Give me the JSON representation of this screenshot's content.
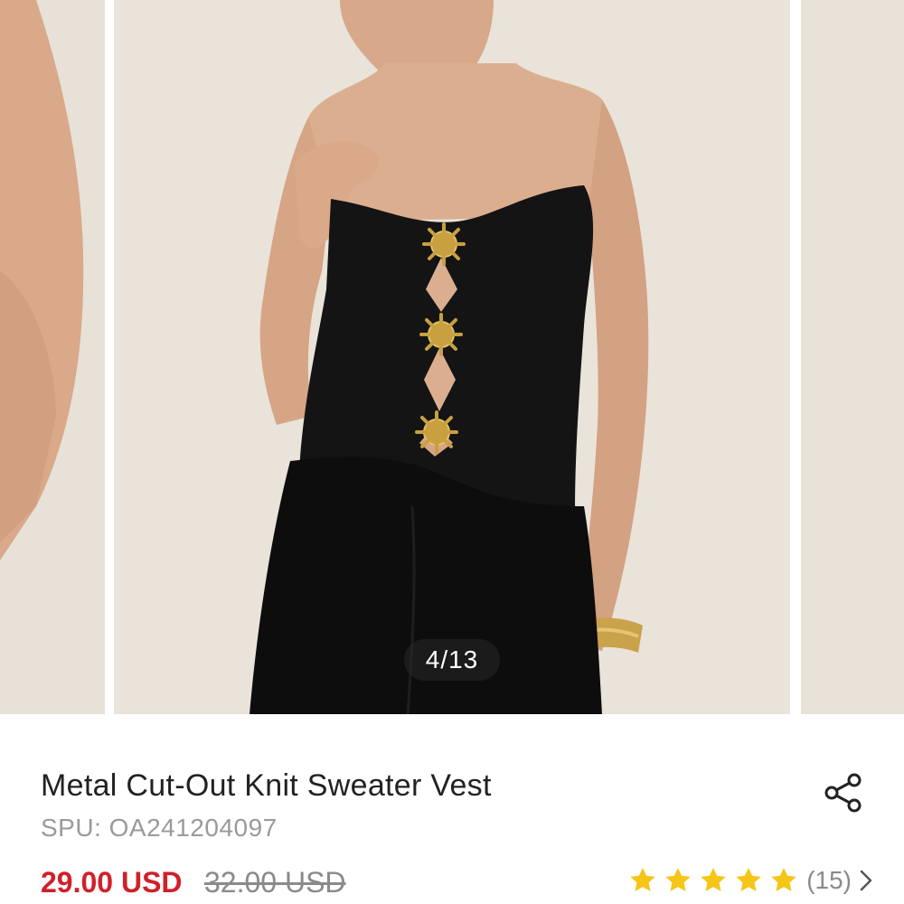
{
  "gallery": {
    "counter": "4/13",
    "current_index": 4,
    "total": 13
  },
  "product": {
    "title": "Metal Cut-Out Knit Sweater Vest",
    "spu": "SPU: OA241204097",
    "price": "29.00 USD",
    "original_price": "32.00 USD",
    "rating_value": 5,
    "rating_max": 5,
    "review_count": "(15)"
  },
  "icons": {
    "share": "share-icon",
    "star": "star-icon",
    "chevron": "chevron-right-icon"
  },
  "colors": {
    "price": "#d0202a",
    "star": "#f5c518",
    "muted": "#8a8a8a"
  }
}
